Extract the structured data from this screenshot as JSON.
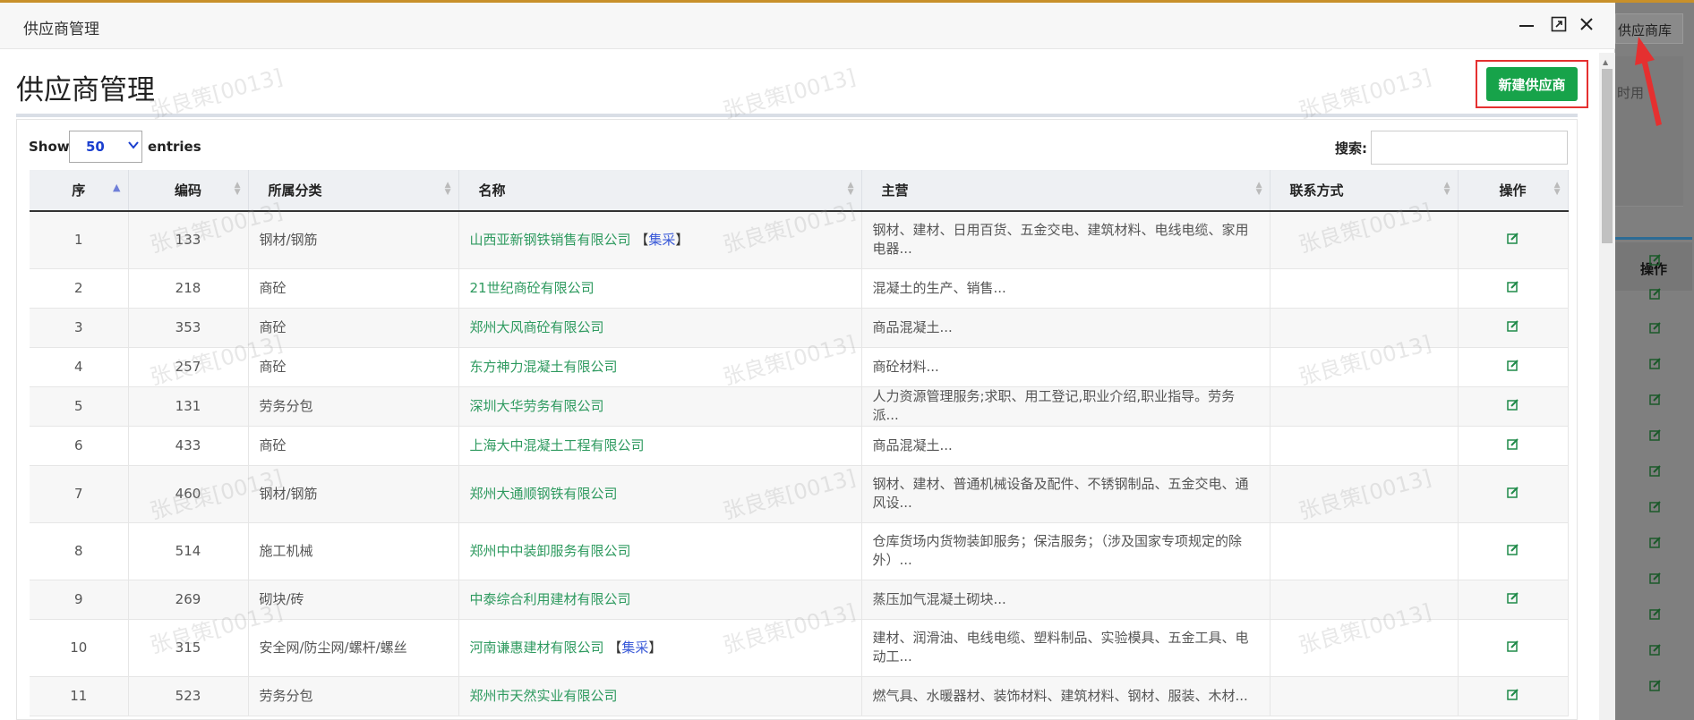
{
  "background": {
    "library_button": "供应商库",
    "side_text": "时用",
    "op_header": "操作"
  },
  "modal": {
    "window_title": "供应商管理",
    "page_title": "供应商管理",
    "new_button": "新建供应商",
    "show_label": "Show",
    "entries_value": "50",
    "entries_label": "entries",
    "search_label": "搜索:",
    "search_value": "",
    "watermark": "张良策[0013]"
  },
  "table": {
    "columns": [
      "序",
      "编码",
      "所属分类",
      "名称",
      "主营",
      "联系方式",
      "操作"
    ],
    "rows": [
      {
        "no": "1",
        "code": "133",
        "category": "钢材/钢筋",
        "name": "山西亚新钢铁销售有限公司",
        "tag": "集采",
        "main": "钢材、建材、日用百货、五金交电、建筑材料、电线电缆、家用电器...",
        "contact": ""
      },
      {
        "no": "2",
        "code": "218",
        "category": "商砼",
        "name": "21世纪商砼有限公司",
        "tag": "",
        "main": "混凝土的生产、销售...",
        "contact": ""
      },
      {
        "no": "3",
        "code": "353",
        "category": "商砼",
        "name": "郑州大风商砼有限公司",
        "tag": "",
        "main": "商品混凝土...",
        "contact": ""
      },
      {
        "no": "4",
        "code": "257",
        "category": "商砼",
        "name": "东方神力混凝土有限公司",
        "tag": "",
        "main": "商砼材料...",
        "contact": ""
      },
      {
        "no": "5",
        "code": "131",
        "category": "劳务分包",
        "name": "深圳大华劳务有限公司",
        "tag": "",
        "main": "人力资源管理服务;求职、用工登记,职业介绍,职业指导。劳务派...",
        "contact": ""
      },
      {
        "no": "6",
        "code": "433",
        "category": "商砼",
        "name": "上海大中混凝土工程有限公司",
        "tag": "",
        "main": "商品混凝土...",
        "contact": ""
      },
      {
        "no": "7",
        "code": "460",
        "category": "钢材/钢筋",
        "name": "郑州大通顺钢铁有限公司",
        "tag": "",
        "main": "钢材、建材、普通机械设备及配件、不锈钢制品、五金交电、通风设...",
        "contact": ""
      },
      {
        "no": "8",
        "code": "514",
        "category": "施工机械",
        "name": "郑州中中装卸服务有限公司",
        "tag": "",
        "main": "仓库货场内货物装卸服务；保洁服务；（涉及国家专项规定的除外）...",
        "contact": ""
      },
      {
        "no": "9",
        "code": "269",
        "category": "砌块/砖",
        "name": "中泰综合利用建材有限公司",
        "tag": "",
        "main": "蒸压加气混凝土砌块...",
        "contact": ""
      },
      {
        "no": "10",
        "code": "315",
        "category": "安全网/防尘网/螺杆/螺丝",
        "name": "河南谦惠建材有限公司",
        "tag": "集采",
        "main": "建材、润滑油、电线电缆、塑料制品、实验模具、五金工具、电动工...",
        "contact": ""
      },
      {
        "no": "11",
        "code": "523",
        "category": "劳务分包",
        "name": "郑州市天然实业有限公司",
        "tag": "",
        "main": "燃气具、水暖器材、装饰材料、建筑材料、钢材、服装、木材...",
        "contact": ""
      }
    ]
  }
}
